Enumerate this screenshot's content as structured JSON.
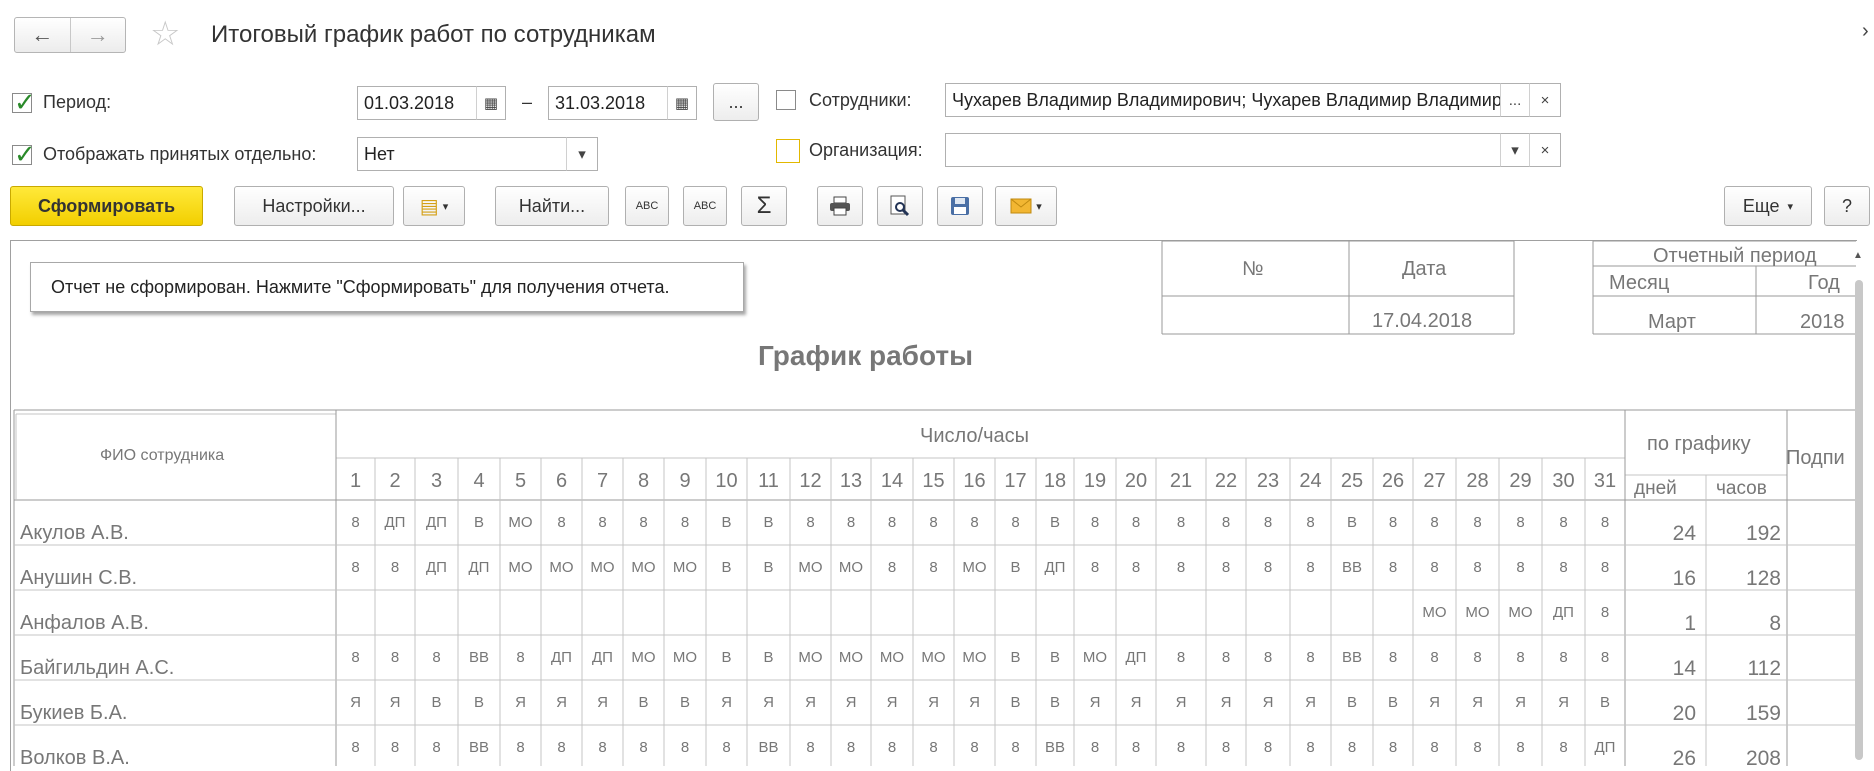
{
  "header": {
    "title": "Итоговый график работ по сотрудникам",
    "back_icon": "←",
    "forward_icon": "→",
    "star_icon": "☆",
    "close_icon": "×"
  },
  "filters": {
    "period_label": "Период:",
    "period_checked": true,
    "date_from": "01.03.2018",
    "date_to": "31.03.2018",
    "dash": "–",
    "period_more": "...",
    "show_separately_label": "Отображать принятых отдельно:",
    "show_separately_checked": true,
    "show_separately_value": "Нет",
    "employees_label": "Сотрудники:",
    "employees_checked": false,
    "employees_value": "Чухарев Владимир Владимирович; Чухарев Владимир Владимирович",
    "employees_more": "...",
    "org_label": "Организация:",
    "org_checked": false,
    "org_value": "",
    "clear_icon": "×",
    "dropdown_icon": "▾"
  },
  "toolbar": {
    "generate_label": "Сформировать",
    "settings_label": "Настройки...",
    "find_label": "Найти...",
    "sum_icon": "Σ",
    "more_label": "Еще",
    "help_label": "?"
  },
  "report": {
    "message": "Отчет не сформирован. Нажмите \"Сформировать\" для получения отчета.",
    "num_header": "№",
    "date_header": "Дата",
    "date_value": "17.04.2018",
    "period_header": "Отчетный период",
    "month_header": "Месяц",
    "year_header": "Год",
    "month_value": "Март",
    "year_value": "2018",
    "title": "График работы",
    "col_fio": "ФИО сотрудника",
    "col_days_hours": "Число/часы",
    "col_schedule": "по графику",
    "col_days": "дней",
    "col_hours": "часов",
    "col_sign": "Подпи",
    "days": [
      "1",
      "2",
      "3",
      "4",
      "5",
      "6",
      "7",
      "8",
      "9",
      "10",
      "11",
      "12",
      "13",
      "14",
      "15",
      "16",
      "17",
      "18",
      "19",
      "20",
      "21",
      "22",
      "23",
      "24",
      "25",
      "26",
      "27",
      "28",
      "29",
      "30",
      "31"
    ],
    "rows": [
      {
        "name": "Акулов А.В.",
        "cells": [
          "8",
          "ДП",
          "ДП",
          "В",
          "МО",
          "8",
          "8",
          "8",
          "8",
          "В",
          "В",
          "8",
          "8",
          "8",
          "8",
          "8",
          "8",
          "В",
          "8",
          "8",
          "8",
          "8",
          "8",
          "8",
          "В",
          "8",
          "8",
          "8",
          "8",
          "8",
          "8"
        ],
        "days": "24",
        "hours": "192"
      },
      {
        "name": "Анушин С.В.",
        "cells": [
          "8",
          "8",
          "ДП",
          "ДП",
          "МО",
          "МО",
          "МО",
          "МО",
          "МО",
          "В",
          "В",
          "МО",
          "МО",
          "8",
          "8",
          "МО",
          "В",
          "ДП",
          "8",
          "8",
          "8",
          "8",
          "8",
          "8",
          "ВВ",
          "8",
          "8",
          "8",
          "8",
          "8",
          "8"
        ],
        "days": "16",
        "hours": "128"
      },
      {
        "name": "Анфалов А.В.",
        "cells": [
          "",
          "",
          "",
          "",
          "",
          "",
          "",
          "",
          "",
          "",
          "",
          "",
          "",
          "",
          "",
          "",
          "",
          "",
          "",
          "",
          "",
          "",
          "",
          "",
          "",
          "",
          "МО",
          "МО",
          "МО",
          "ДП",
          "8"
        ],
        "days": "1",
        "hours": "8"
      },
      {
        "name": "Байгильдин А.С.",
        "cells": [
          "8",
          "8",
          "8",
          "ВВ",
          "8",
          "ДП",
          "ДП",
          "МО",
          "МО",
          "В",
          "В",
          "МО",
          "МО",
          "МО",
          "МО",
          "МО",
          "В",
          "В",
          "МО",
          "ДП",
          "8",
          "8",
          "8",
          "8",
          "ВВ",
          "8",
          "8",
          "8",
          "8",
          "8",
          "8"
        ],
        "days": "14",
        "hours": "112"
      },
      {
        "name": "Букиев Б.А.",
        "cells": [
          "Я",
          "Я",
          "В",
          "В",
          "Я",
          "Я",
          "Я",
          "В",
          "В",
          "Я",
          "Я",
          "Я",
          "Я",
          "Я",
          "Я",
          "Я",
          "В",
          "В",
          "Я",
          "Я",
          "Я",
          "Я",
          "Я",
          "Я",
          "В",
          "В",
          "Я",
          "Я",
          "Я",
          "Я",
          "В"
        ],
        "days": "20",
        "hours": "159"
      },
      {
        "name": "Волков В.А.",
        "cells": [
          "8",
          "8",
          "8",
          "ВВ",
          "8",
          "8",
          "8",
          "8",
          "8",
          "8",
          "ВВ",
          "8",
          "8",
          "8",
          "8",
          "8",
          "8",
          "ВВ",
          "8",
          "8",
          "8",
          "8",
          "8",
          "8",
          "8",
          "8",
          "8",
          "8",
          "8",
          "8",
          "ДП"
        ],
        "days": "26",
        "hours": "208"
      }
    ]
  }
}
